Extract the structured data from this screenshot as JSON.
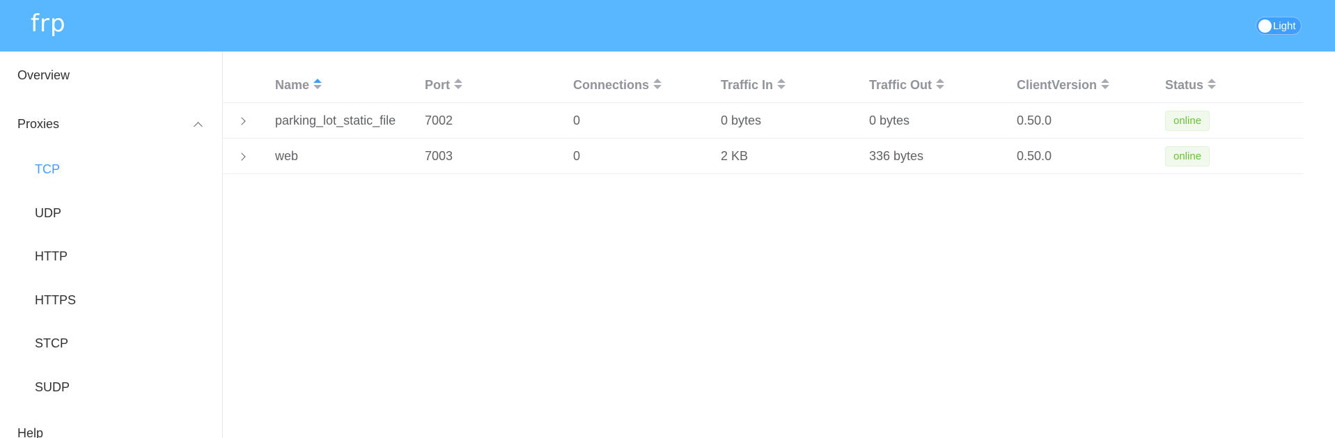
{
  "header": {
    "logo": "frp",
    "theme_label": "Light"
  },
  "sidebar": {
    "overview": "Overview",
    "proxies": "Proxies",
    "items": [
      "TCP",
      "UDP",
      "HTTP",
      "HTTPS",
      "STCP",
      "SUDP"
    ],
    "active_item": "TCP",
    "help": "Help"
  },
  "table": {
    "columns": [
      "Name",
      "Port",
      "Connections",
      "Traffic In",
      "Traffic Out",
      "ClientVersion",
      "Status"
    ],
    "sorted_column": "Name",
    "rows": [
      {
        "name": "parking_lot_static_file",
        "port": "7002",
        "connections": "0",
        "traffic_in": "0 bytes",
        "traffic_out": "0 bytes",
        "client_version": "0.50.0",
        "status": "online"
      },
      {
        "name": "web",
        "port": "7003",
        "connections": "0",
        "traffic_in": "2 KB",
        "traffic_out": "336 bytes",
        "client_version": "0.50.0",
        "status": "online"
      }
    ]
  },
  "colors": {
    "header_bg": "#58b7ff",
    "accent": "#409eff",
    "online": "#67c23a"
  }
}
